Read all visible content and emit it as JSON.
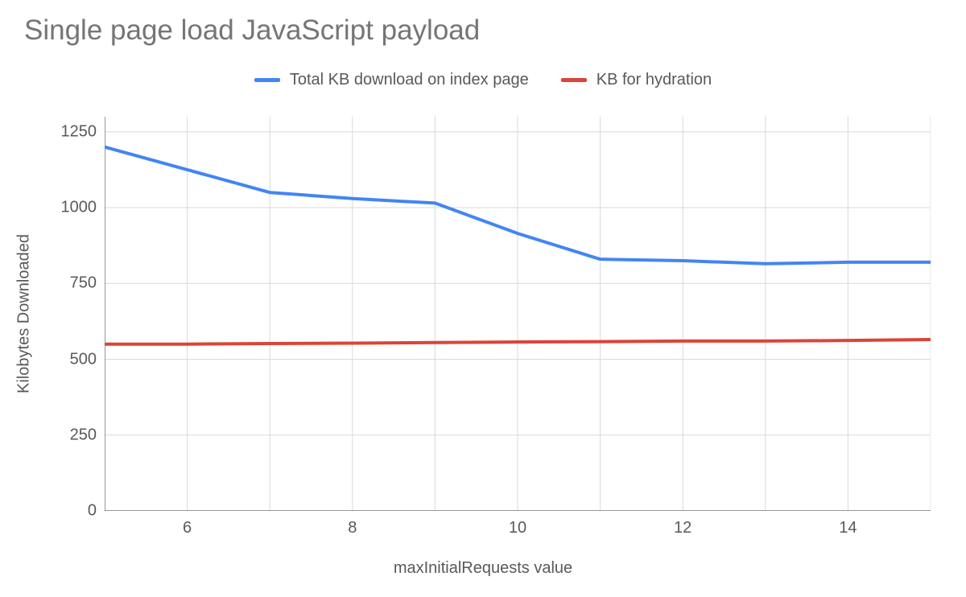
{
  "chart_data": {
    "type": "line",
    "title": "Single page load JavaScript payload",
    "xlabel": "maxInitialRequests value",
    "ylabel": "Kilobytes Downloaded",
    "x": [
      5,
      6,
      7,
      8,
      9,
      10,
      11,
      12,
      13,
      14,
      15
    ],
    "x_ticks": [
      6,
      8,
      10,
      12,
      14
    ],
    "y_ticks": [
      0,
      250,
      500,
      750,
      1000,
      1250
    ],
    "xlim": [
      5,
      15
    ],
    "ylim": [
      0,
      1300
    ],
    "series": [
      {
        "name": "Total KB download on index page",
        "color": "#4285f4",
        "values": [
          1200,
          1125,
          1050,
          1030,
          1015,
          915,
          830,
          825,
          815,
          820,
          820
        ]
      },
      {
        "name": "KB for hydration",
        "color": "#db4437",
        "values": [
          550,
          550,
          552,
          553,
          555,
          557,
          558,
          560,
          560,
          562,
          565
        ]
      }
    ]
  }
}
